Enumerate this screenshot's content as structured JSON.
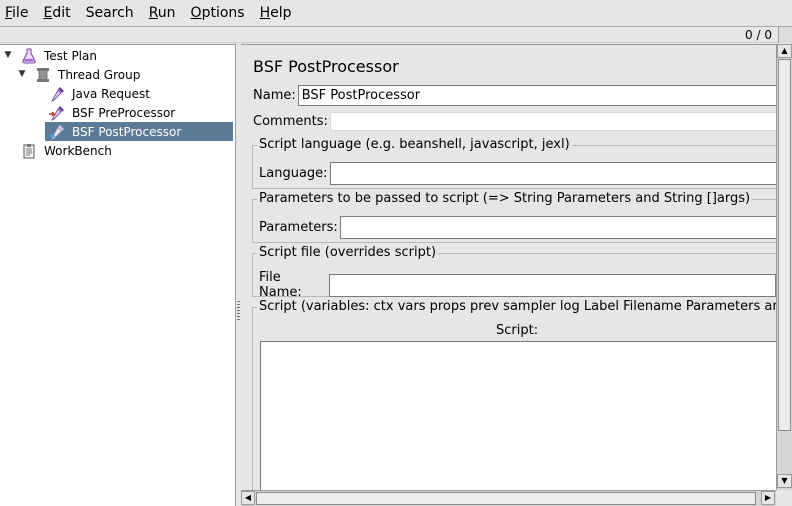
{
  "menubar": {
    "items": [
      {
        "mnemonic": "F",
        "rest": "ile"
      },
      {
        "mnemonic": "E",
        "rest": "dit"
      },
      {
        "mnemonic": "",
        "rest": "Search"
      },
      {
        "mnemonic": "R",
        "rest": "un"
      },
      {
        "mnemonic": "O",
        "rest": "ptions"
      },
      {
        "mnemonic": "H",
        "rest": "elp"
      }
    ]
  },
  "status": {
    "counter": "0 / 0"
  },
  "tree": {
    "nodes": [
      {
        "label": "Test Plan",
        "icon": "flask-icon"
      },
      {
        "label": "Thread Group",
        "icon": "spool-icon"
      },
      {
        "label": "Java Request",
        "icon": "pipette-icon"
      },
      {
        "label": "BSF PreProcessor",
        "icon": "pipette-arrow-icon"
      },
      {
        "label": "BSF PostProcessor",
        "icon": "pipette-arrow-icon"
      },
      {
        "label": "WorkBench",
        "icon": "clipboard-icon"
      }
    ],
    "selected_index": 4
  },
  "editor": {
    "title": "BSF PostProcessor",
    "name_label": "Name:",
    "name_value": "BSF PostProcessor",
    "comments_label": "Comments:",
    "comments_value": "",
    "script_language": {
      "group_title": "Script language (e.g. beanshell, javascript, jexl)",
      "label": "Language:",
      "value": ""
    },
    "parameters": {
      "group_title": "Parameters to be passed to script (=> String Parameters and String []args)",
      "label": "Parameters:",
      "value": ""
    },
    "script_file": {
      "group_title": "Script file (overrides script)",
      "label": "File Name:",
      "value": ""
    },
    "script": {
      "group_title": "Script (variables: ctx vars props prev sampler log Label Filename Parameters args[] OUT)",
      "label": "Script:",
      "value": ""
    }
  },
  "colors": {
    "selection": "#5c7b97",
    "window_bg": "#e6e6e6"
  }
}
